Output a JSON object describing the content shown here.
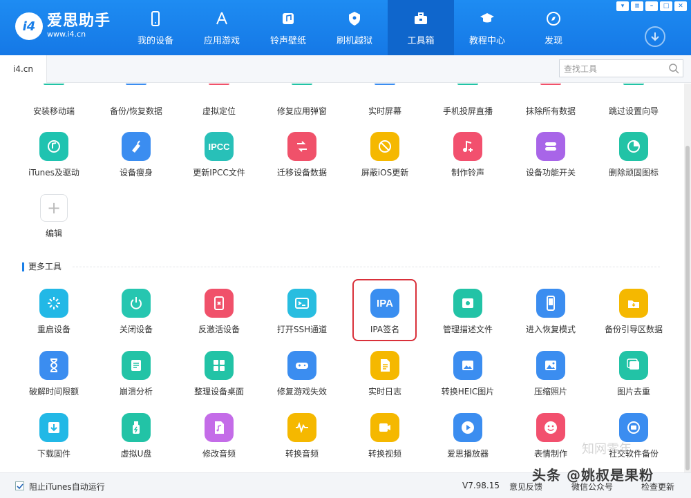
{
  "app": {
    "name": "爱思助手",
    "url": "www.i4.cn",
    "logo_mark": "i4"
  },
  "nav": [
    {
      "label": "我的设备",
      "icon": "phone-icon"
    },
    {
      "label": "应用游戏",
      "icon": "app-store-icon"
    },
    {
      "label": "铃声壁纸",
      "icon": "music-wallpaper-icon"
    },
    {
      "label": "刷机越狱",
      "icon": "jailbreak-icon"
    },
    {
      "label": "工具箱",
      "icon": "toolbox-icon",
      "active": true
    },
    {
      "label": "教程中心",
      "icon": "graduation-cap-icon"
    },
    {
      "label": "发现",
      "icon": "compass-icon"
    }
  ],
  "tabbar": {
    "tab": "i4.cn",
    "search_placeholder": "查找工具"
  },
  "top_labels": [
    "安装移动端",
    "备份/恢复数据",
    "虚拟定位",
    "修复应用弹窗",
    "实时屏幕",
    "手机投屏直播",
    "抹除所有数据",
    "跳过设置向导"
  ],
  "row2": [
    {
      "label": "iTunes及驱动",
      "color": "#1fc3b0",
      "icon": "music-gear-icon"
    },
    {
      "label": "设备瘦身",
      "color": "#3b8df0",
      "icon": "broom-icon"
    },
    {
      "label": "更新IPCC文件",
      "color": "#28c0b8",
      "icon": "ipcc-icon",
      "text": "IPCC"
    },
    {
      "label": "迁移设备数据",
      "color": "#f0516a",
      "icon": "transfer-icon"
    },
    {
      "label": "屏蔽iOS更新",
      "color": "#f5b800",
      "icon": "block-update-icon"
    },
    {
      "label": "制作铃声",
      "color": "#f2506e",
      "icon": "ringtone-icon"
    },
    {
      "label": "设备功能开关",
      "color": "#a865e8",
      "icon": "toggle-icon"
    },
    {
      "label": "删除顽固图标",
      "color": "#22c3a6",
      "icon": "pie-icon"
    }
  ],
  "edit": {
    "label": "编辑",
    "symbol": "+"
  },
  "section": {
    "title": "更多工具"
  },
  "more_tools": [
    {
      "label": "重启设备",
      "color": "#22b8e6",
      "icon": "restart-icon"
    },
    {
      "label": "关闭设备",
      "color": "#26c6b0",
      "icon": "power-icon"
    },
    {
      "label": "反激活设备",
      "color": "#f0516a",
      "icon": "deactivate-icon"
    },
    {
      "label": "打开SSH通道",
      "color": "#28bde0",
      "icon": "terminal-icon"
    },
    {
      "label": "IPA签名",
      "color": "#3a8ef0",
      "icon": "ipa-icon",
      "text": "IPA"
    },
    {
      "label": "管理描述文件",
      "color": "#22c3a6",
      "icon": "profile-gear-icon"
    },
    {
      "label": "进入恢复模式",
      "color": "#3b8df0",
      "icon": "recovery-icon"
    },
    {
      "label": "备份引导区数据",
      "color": "#f5b800",
      "icon": "backup-boot-icon"
    },
    {
      "label": "破解时间限额",
      "color": "#3b8df0",
      "icon": "hourglass-icon"
    },
    {
      "label": "崩溃分析",
      "color": "#22c3a6",
      "icon": "crash-log-icon"
    },
    {
      "label": "整理设备桌面",
      "color": "#22c3a6",
      "icon": "grid-icon"
    },
    {
      "label": "修复游戏失效",
      "color": "#3b8df0",
      "icon": "gamepad-icon"
    },
    {
      "label": "实时日志",
      "color": "#f5b800",
      "icon": "log-icon"
    },
    {
      "label": "转换HEIC图片",
      "color": "#3b8df0",
      "icon": "heic-icon"
    },
    {
      "label": "压缩照片",
      "color": "#3b8df0",
      "icon": "photo-icon"
    },
    {
      "label": "图片去重",
      "color": "#22c3a6",
      "icon": "dedupe-icon"
    },
    {
      "label": "下载固件",
      "color": "#22b8e6",
      "icon": "download-firmware-icon"
    },
    {
      "label": "虚拟U盘",
      "color": "#22c3a6",
      "icon": "usb-drive-icon"
    },
    {
      "label": "修改音频",
      "color": "#c46ce8",
      "icon": "audio-edit-icon"
    },
    {
      "label": "转换音频",
      "color": "#f5b800",
      "icon": "audio-convert-icon"
    },
    {
      "label": "转换视频",
      "color": "#f5b800",
      "icon": "video-convert-icon"
    },
    {
      "label": "爱思播放器",
      "color": "#3b8df0",
      "icon": "player-icon"
    },
    {
      "label": "表情制作",
      "color": "#f2506e",
      "icon": "emoji-icon"
    },
    {
      "label": "社交软件备份",
      "color": "#3b8df0",
      "icon": "social-backup-icon"
    }
  ],
  "statusbar": {
    "checkbox_label": "阻止iTunes自动运行",
    "version": "V7.98.15",
    "feedback": "意见反馈",
    "wechat": "微信公众号",
    "update": "检查更新"
  },
  "watermark": {
    "main": "头条 @姚叔是果粉",
    "secondary": "知网零年"
  }
}
